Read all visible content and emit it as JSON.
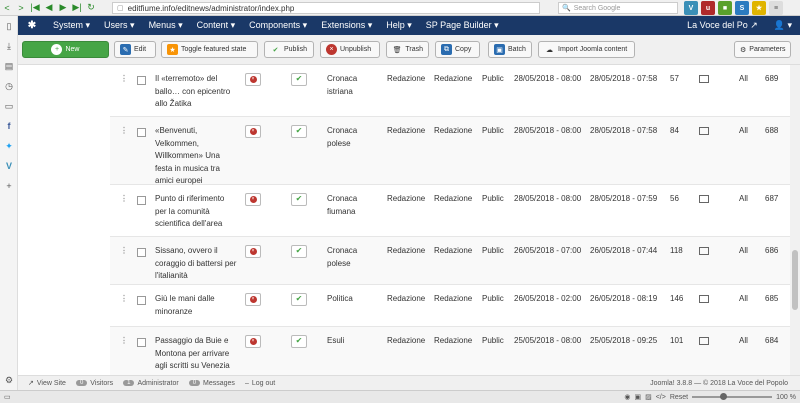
{
  "browser": {
    "url": "editfiume.info/editnews/administrator/index.php",
    "search_placeholder": "Search Google",
    "zoom_level": "100 %",
    "reset_label": "Reset"
  },
  "topmenu": {
    "items": [
      "System ▾",
      "Users ▾",
      "Menus ▾",
      "Content ▾",
      "Components ▾",
      "Extensions ▾",
      "Help ▾",
      "SP Page Builder ▾"
    ],
    "site_name": "La Voce del Po ↗",
    "user_label": "👤 ▾"
  },
  "toolbar": {
    "new": "New",
    "edit": "Edit",
    "toggle_featured": "Toggle featured state",
    "publish": "Publish",
    "unpublish": "Unpublish",
    "trash": "Trash",
    "copy": "Copy",
    "batch": "Batch",
    "import": "Import Joomla content",
    "parameters": "Parameters"
  },
  "rows": [
    {
      "title": "Il «terremoto» del ballo… con epicentro allo Žatika",
      "category": "Cronaca istriana",
      "author": "Redazione",
      "created_by": "Redazione",
      "access": "Public",
      "date1": "28/05/2018 - 08:00",
      "date2": "28/05/2018 - 07:58",
      "hits": "57",
      "language": "All",
      "id": "689"
    },
    {
      "title": "«Benvenuti, Velkommen, Willkommen» Una festa in musica tra amici europei",
      "category": "Cronaca polese",
      "author": "Redazione",
      "created_by": "Redazione",
      "access": "Public",
      "date1": "28/05/2018 - 08:00",
      "date2": "28/05/2018 - 07:58",
      "hits": "84",
      "language": "All",
      "id": "688"
    },
    {
      "title": "Punto di riferimento per la comunità scientifica dell'area",
      "category": "Cronaca fiumana",
      "author": "Redazione",
      "created_by": "Redazione",
      "access": "Public",
      "date1": "28/05/2018 - 08:00",
      "date2": "28/05/2018 - 07:59",
      "hits": "56",
      "language": "All",
      "id": "687"
    },
    {
      "title": "Sissano, ovvero il coraggio di battersi per l'italianità",
      "category": "Cronaca polese",
      "author": "Redazione",
      "created_by": "Redazione",
      "access": "Public",
      "date1": "26/05/2018 - 07:00",
      "date2": "26/05/2018 - 07:44",
      "hits": "118",
      "language": "All",
      "id": "686"
    },
    {
      "title": "Giù le mani dalle minoranze",
      "category": "Politica",
      "author": "Redazione",
      "created_by": "Redazione",
      "access": "Public",
      "date1": "26/05/2018 - 02:00",
      "date2": "26/05/2018 - 08:19",
      "hits": "146",
      "language": "All",
      "id": "685"
    },
    {
      "title": "Passaggio da Buie e Montona per arrivare agli scritti su Venezia",
      "category": "Esuli",
      "author": "Redazione",
      "created_by": "Redazione",
      "access": "Public",
      "date1": "25/05/2018 - 08:00",
      "date2": "25/05/2018 - 09:25",
      "hits": "101",
      "language": "All",
      "id": "684"
    }
  ],
  "status": {
    "view_site": "View Site",
    "visitors_count": "0",
    "visitors_label": "Visitors",
    "admin_count": "1",
    "admin_label": "Administrator",
    "messages_count": "0",
    "messages_label": "Messages",
    "logout": "Log out",
    "version": "Joomla! 3.8.8 — © 2018 La Voce del Popolo"
  }
}
